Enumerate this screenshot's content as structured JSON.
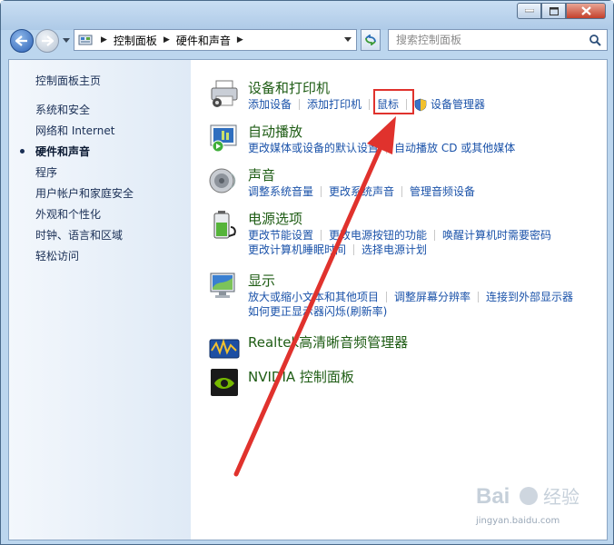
{
  "window": {
    "close_icon": "close-icon",
    "minimize_icon": "minimize-icon",
    "maximize_icon": "maximize-icon"
  },
  "breadcrumb": {
    "items": [
      "控制面板",
      "硬件和声音"
    ]
  },
  "search": {
    "placeholder": "搜索控制面板"
  },
  "sidebar": {
    "home": "控制面板主页",
    "items": [
      "系统和安全",
      "网络和 Internet",
      "硬件和声音",
      "程序",
      "用户帐户和家庭安全",
      "外观和个性化",
      "时钟、语言和区域",
      "轻松访问"
    ],
    "current_index": 2
  },
  "categories": [
    {
      "title": "设备和打印机",
      "icon": "printer-icon",
      "rows": [
        [
          "添加设备",
          "添加打印机",
          "鼠标",
          "设备管理器"
        ]
      ]
    },
    {
      "title": "自动播放",
      "icon": "autoplay-icon",
      "rows": [
        [
          "更改媒体或设备的默认设置",
          "自动播放 CD 或其他媒体"
        ]
      ]
    },
    {
      "title": "声音",
      "icon": "speaker-icon",
      "rows": [
        [
          "调整系统音量",
          "更改系统声音",
          "管理音频设备"
        ]
      ]
    },
    {
      "title": "电源选项",
      "icon": "battery-icon",
      "rows": [
        [
          "更改节能设置",
          "更改电源按钮的功能",
          "唤醒计算机时需要密码"
        ],
        [
          "更改计算机睡眠时间",
          "选择电源计划"
        ]
      ]
    },
    {
      "title": "显示",
      "icon": "monitor-icon",
      "rows": [
        [
          "放大或缩小文本和其他项目",
          "调整屏幕分辨率",
          "连接到外部显示器"
        ],
        [
          "如何更正显示器闪烁(刷新率)"
        ]
      ]
    },
    {
      "title": "Realtek高清晰音频管理器",
      "icon": "realtek-audio-icon",
      "rows": []
    },
    {
      "title": "NVIDIA 控制面板",
      "icon": "nvidia-icon",
      "rows": []
    }
  ],
  "annotation": {
    "color": "#e0322d"
  },
  "watermark": {
    "brand": "Bai du 经验",
    "site": "jingyan.baidu.com"
  },
  "colors": {
    "category_title": "#1e5c14",
    "link": "#1a52a9",
    "sidebar_text": "#1a2f55"
  }
}
